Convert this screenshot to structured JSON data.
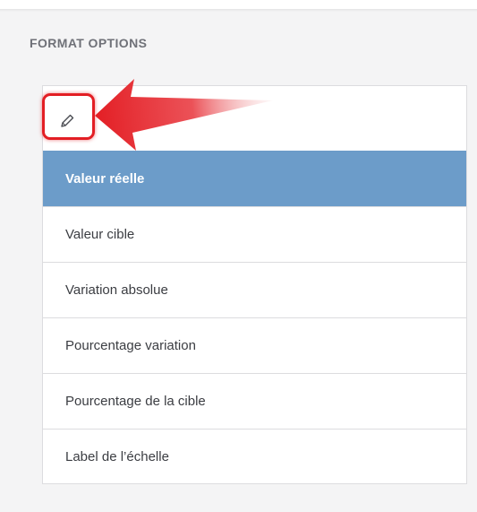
{
  "section": {
    "title": "FORMAT OPTIONS"
  },
  "edit": {
    "icon": "pencil-icon"
  },
  "options": [
    {
      "label": "Valeur réelle",
      "selected": true
    },
    {
      "label": "Valeur cible",
      "selected": false
    },
    {
      "label": "Variation absolue",
      "selected": false
    },
    {
      "label": "Pourcentage variation",
      "selected": false
    },
    {
      "label": "Pourcentage de la cible",
      "selected": false
    },
    {
      "label": "Label de l’échelle",
      "selected": false
    }
  ],
  "colors": {
    "selected_bg": "#6c9cc9",
    "annotation": "#e31e24"
  }
}
